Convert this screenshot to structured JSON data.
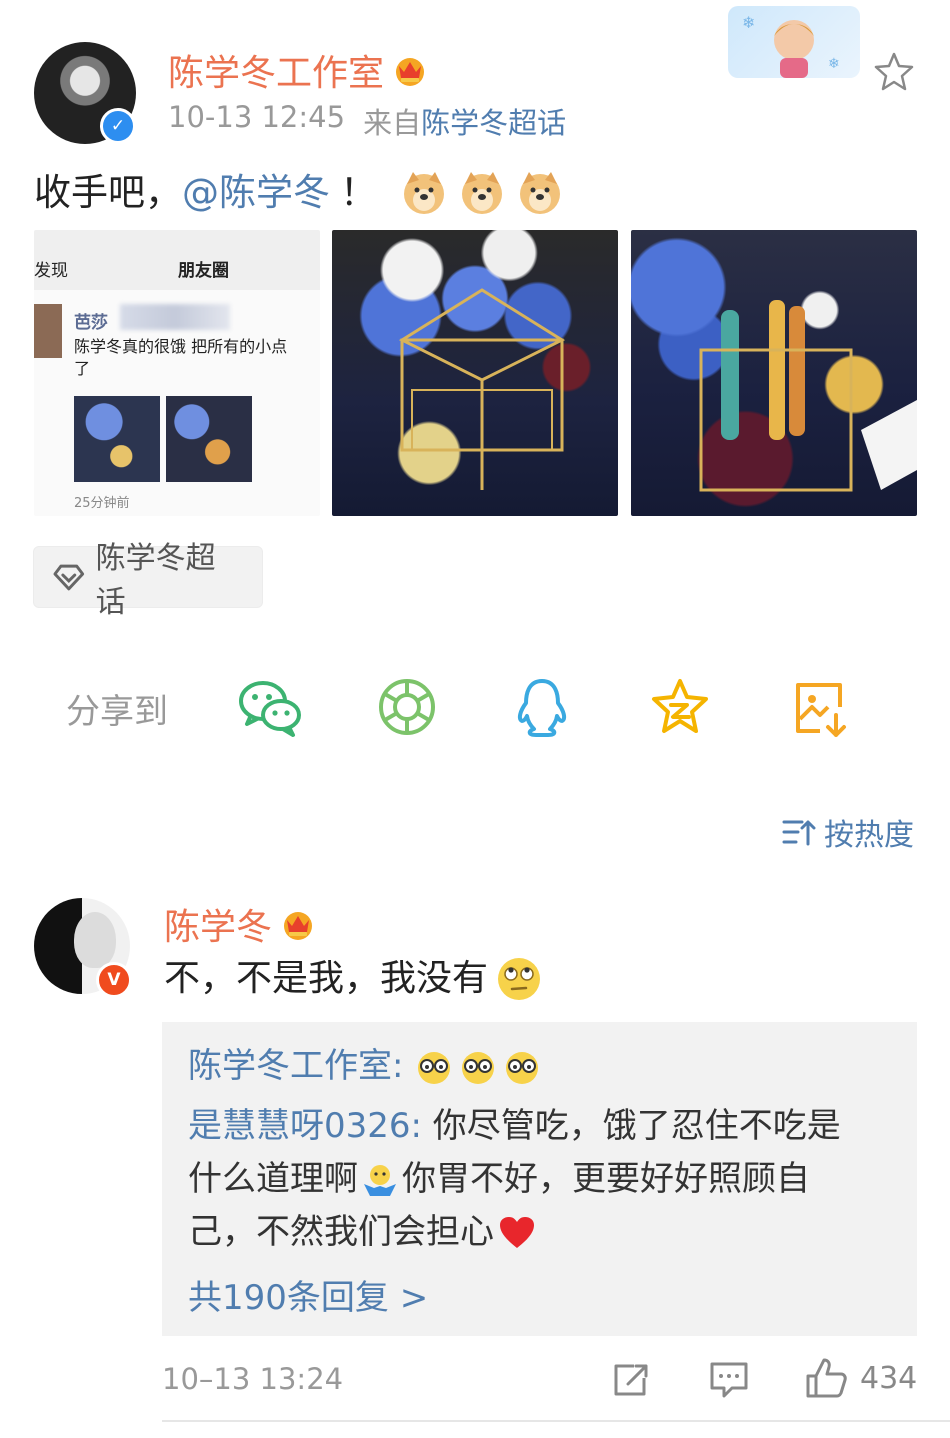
{
  "post": {
    "author_name": "陈学冬工作室",
    "timestamp": "10-13 12:45",
    "source_prefix": "来自",
    "source_name": "陈学冬超话",
    "text_prefix": "收手吧，",
    "mention": "@陈学冬",
    "text_suffix": "！",
    "topic_chip": "陈学冬超话",
    "images": {
      "screenshot": {
        "tab_left": "发现",
        "tab_title": "朋友圈",
        "user_name": "芭莎",
        "message_line1": "陈学冬真的很饿 把所有的小点",
        "message_line2": "了",
        "time_ago": "25分钟前"
      }
    }
  },
  "share": {
    "label": "分享到",
    "targets": [
      "wechat-icon",
      "moments-icon",
      "qq-icon",
      "qzone-icon",
      "save-image-icon"
    ],
    "colors": {
      "wechat": "#3cb371",
      "moments": "#7cc36a",
      "qq": "#3aa9e0",
      "qzone": "#f5b400",
      "save": "#f5a623"
    }
  },
  "sort": {
    "label": "按热度"
  },
  "comment": {
    "author_name": "陈学冬",
    "text": "不，不是我，我没有",
    "replies": [
      {
        "user": "陈学冬工作室",
        "text": ""
      },
      {
        "user": "是慧慧呀0326",
        "line1": "你尽管吃，饿了忍住不吃是",
        "line2a": "什么道理啊",
        "line2b": "你胃不好，更要好好照顾自",
        "line3": "己，不然我们会担心"
      }
    ],
    "more_replies": "共190条回复 >",
    "timestamp": "10–13 13:24",
    "like_count": "434"
  },
  "colors": {
    "orange_name": "#eb7350",
    "link_blue": "#507daf",
    "gray_text": "#999999",
    "verify_blue": "#2d8ef0",
    "verify_orange": "#f04b1e"
  }
}
